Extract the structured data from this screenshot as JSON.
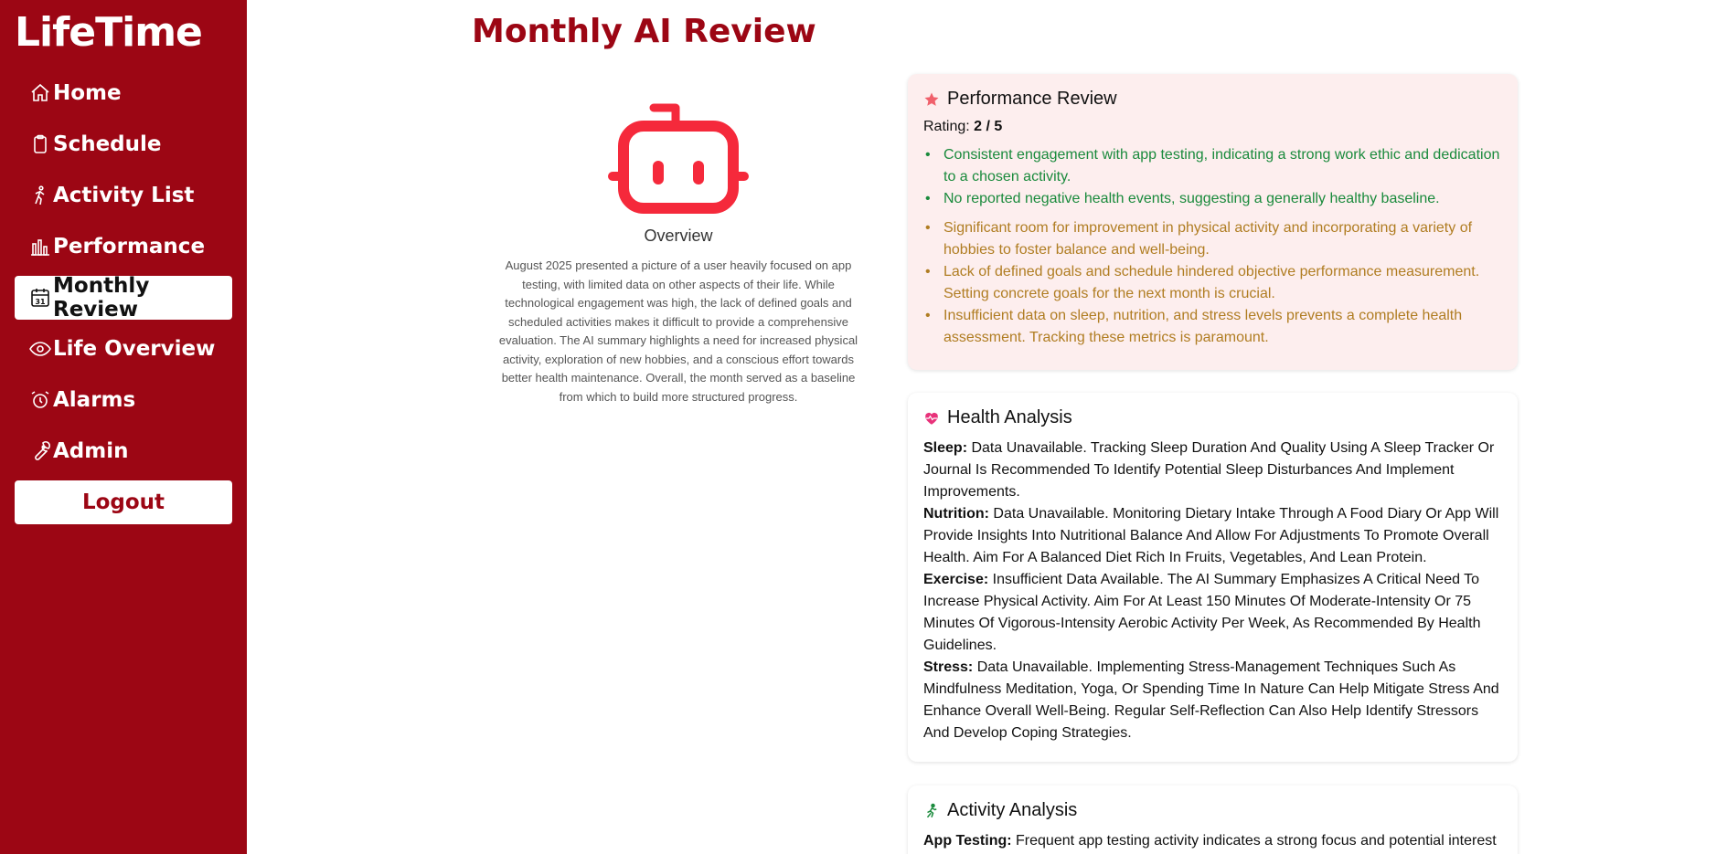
{
  "app": {
    "brand": "LifeTime"
  },
  "sidebar": {
    "items": [
      {
        "label": "Home",
        "icon": "home-icon",
        "active": false
      },
      {
        "label": "Schedule",
        "icon": "clipboard-icon",
        "active": false
      },
      {
        "label": "Activity List",
        "icon": "walking-icon",
        "active": false
      },
      {
        "label": "Performance",
        "icon": "bar-chart-icon",
        "active": false
      },
      {
        "label": "Monthly Review",
        "icon": "calendar-icon",
        "active": true
      },
      {
        "label": "Life Overview",
        "icon": "eye-icon",
        "active": false
      },
      {
        "label": "Alarms",
        "icon": "alarm-clock-icon",
        "active": false
      },
      {
        "label": "Admin",
        "icon": "wrench-icon",
        "active": false
      }
    ],
    "logout_label": "Logout"
  },
  "page": {
    "title": "Monthly AI Review"
  },
  "overview": {
    "icon": "robot-icon",
    "title": "Overview",
    "text": "August 2025 presented a picture of a user heavily focused on app testing, with limited data on other aspects of their life. While technological engagement was high, the lack of defined goals and scheduled activities makes it difficult to provide a comprehensive evaluation. The AI summary highlights a need for increased physical activity, exploration of new hobbies, and a conscious effort towards better health maintenance. Overall, the month served as a baseline from which to build more structured progress."
  },
  "performance": {
    "icon": "star-icon",
    "title": "Performance Review",
    "rating_label": "Rating:",
    "rating_value": "2 / 5",
    "positives": [
      "Consistent engagement with app testing, indicating a strong work ethic and dedication to a chosen activity.",
      "No reported negative health events, suggesting a generally healthy baseline."
    ],
    "negatives": [
      "Significant room for improvement in physical activity and incorporating a variety of hobbies to foster balance and well-being.",
      "Lack of defined goals and schedule hindered objective performance measurement. Setting concrete goals for the next month is crucial.",
      "Insufficient data on sleep, nutrition, and stress levels prevents a complete health assessment. Tracking these metrics is paramount."
    ],
    "colors": {
      "positive": "#1a8a3c",
      "negative": "#b07d22",
      "background": "#fdeeee"
    }
  },
  "health": {
    "icon": "heartbeat-icon",
    "title": "Health Analysis",
    "entries": [
      {
        "label": "Sleep:",
        "text": " Data Unavailable. Tracking Sleep Duration And Quality Using A Sleep Tracker Or Journal Is Recommended To Identify Potential Sleep Disturbances And Implement Improvements."
      },
      {
        "label": "Nutrition:",
        "text": " Data Unavailable. Monitoring Dietary Intake Through A Food Diary Or App Will Provide Insights Into Nutritional Balance And Allow For Adjustments To Promote Overall Health. Aim For A Balanced Diet Rich In Fruits, Vegetables, And Lean Protein."
      },
      {
        "label": "Exercise:",
        "text": " Insufficient Data Available. The AI Summary Emphasizes A Critical Need To Increase Physical Activity. Aim For At Least 150 Minutes Of Moderate-Intensity Or 75 Minutes Of Vigorous-Intensity Aerobic Activity Per Week, As Recommended By Health Guidelines."
      },
      {
        "label": "Stress:",
        "text": " Data Unavailable. Implementing Stress-Management Techniques Such As Mindfulness Meditation, Yoga, Or Spending Time In Nature Can Help Mitigate Stress And Enhance Overall Well-Being. Regular Self-Reflection Can Also Help Identify Stressors And Develop Coping Strategies."
      }
    ]
  },
  "activity": {
    "icon": "running-icon",
    "title": "Activity Analysis",
    "entries": [
      {
        "label": "App Testing:",
        "text": " Frequent app testing activity indicates a strong focus and potential interest"
      }
    ]
  },
  "colors": {
    "brand": "#9c0614",
    "robot": "#f5293b"
  }
}
